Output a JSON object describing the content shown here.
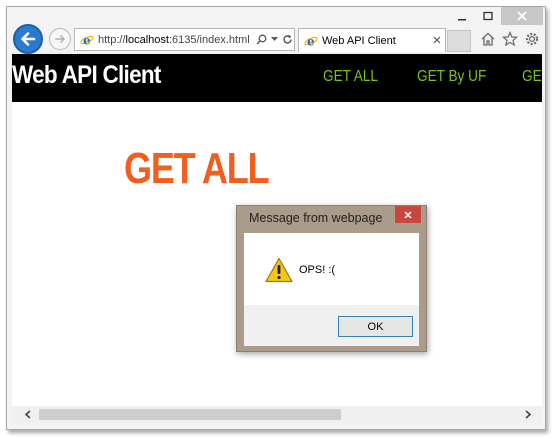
{
  "browser": {
    "address": {
      "prefix": "http://",
      "host": "localhost",
      "rest": ":6135/index.html"
    },
    "tab": {
      "title": "Web API Client"
    },
    "icons": [
      "back-arrow-icon",
      "forward-arrow-icon",
      "ie-logo-icon",
      "search-icon",
      "dropdown-icon",
      "refresh-icon",
      "close-icon",
      "home-icon",
      "star-icon",
      "gear-icon"
    ]
  },
  "site": {
    "brand": "Web API Client",
    "nav": [
      "GET ALL",
      "GET By UF",
      "GET"
    ],
    "heading": "GET ALL",
    "colors": {
      "header_bg": "#000000",
      "nav": "#7ec312",
      "heading": "#f15e1e"
    }
  },
  "dialog": {
    "title": "Message from webpage",
    "message": "OPS! :(",
    "ok_label": "OK",
    "icon": "warning-icon"
  }
}
